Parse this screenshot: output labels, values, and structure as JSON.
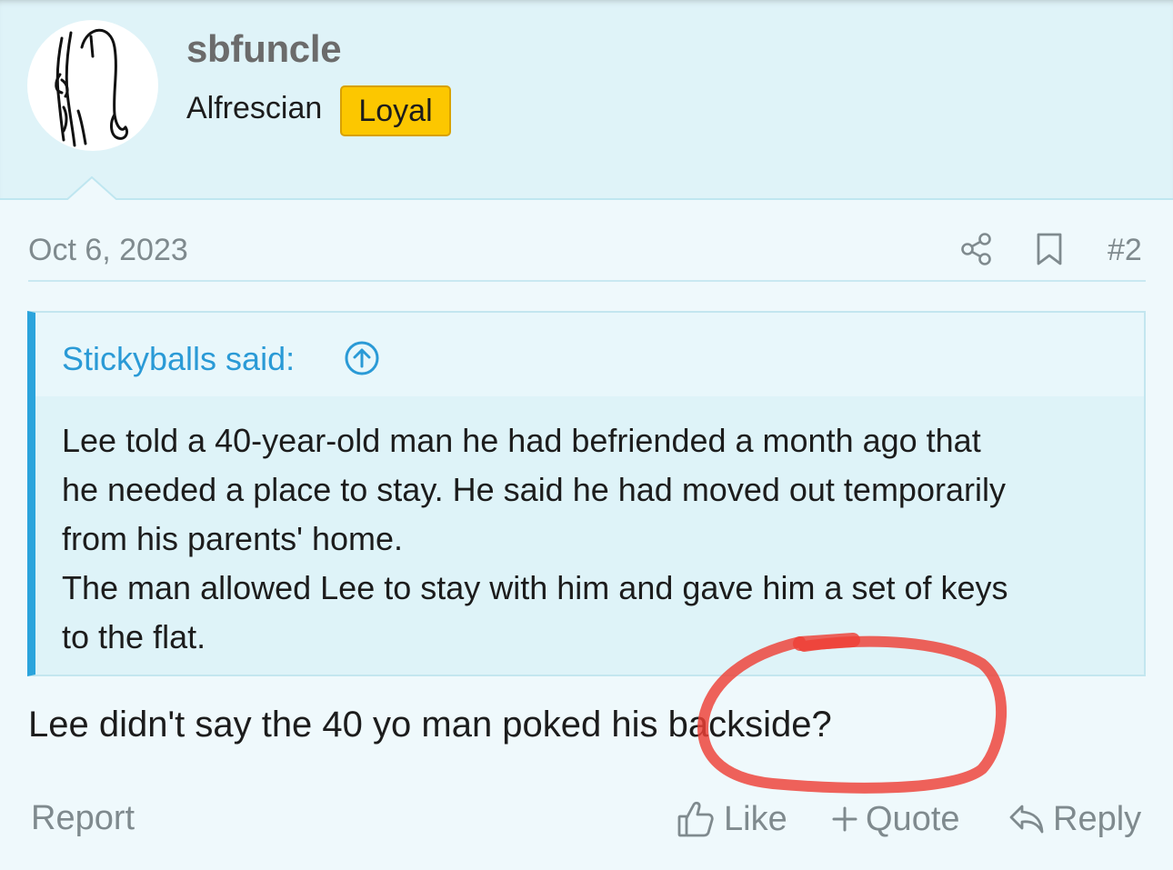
{
  "user": {
    "name": "sbfuncle",
    "title": "Alfrescian",
    "badge": "Loyal"
  },
  "post": {
    "date": "Oct 6, 2023",
    "number": "#2",
    "text": "Lee didn't say the 40 yo man poked his backside?"
  },
  "quote": {
    "author_label": "Stickyballs said:",
    "lines": [
      "Lee told a 40-year-old man he had befriended a month ago that",
      "he needed a place to stay. He said he had moved out temporarily",
      "from his parents' home.",
      "The man allowed Lee to stay with him and gave him a set of keys",
      "to the flat."
    ]
  },
  "actions": {
    "report": "Report",
    "like": "Like",
    "quote": "Quote",
    "reply": "Reply"
  },
  "icons": {
    "share": "share-icon",
    "bookmark": "bookmark-icon",
    "quote_jump": "arrow-up-circle-icon",
    "like": "thumbs-up-icon",
    "quote": "plus-icon",
    "reply": "reply-arrow-icon"
  },
  "colors": {
    "header_bg": "#dff3f8",
    "page_bg": "#eff9fc",
    "badge": "#fcc700",
    "quote_accent": "#2ba4dc",
    "link": "#2a9ad6",
    "annotation": "#ee4036"
  }
}
